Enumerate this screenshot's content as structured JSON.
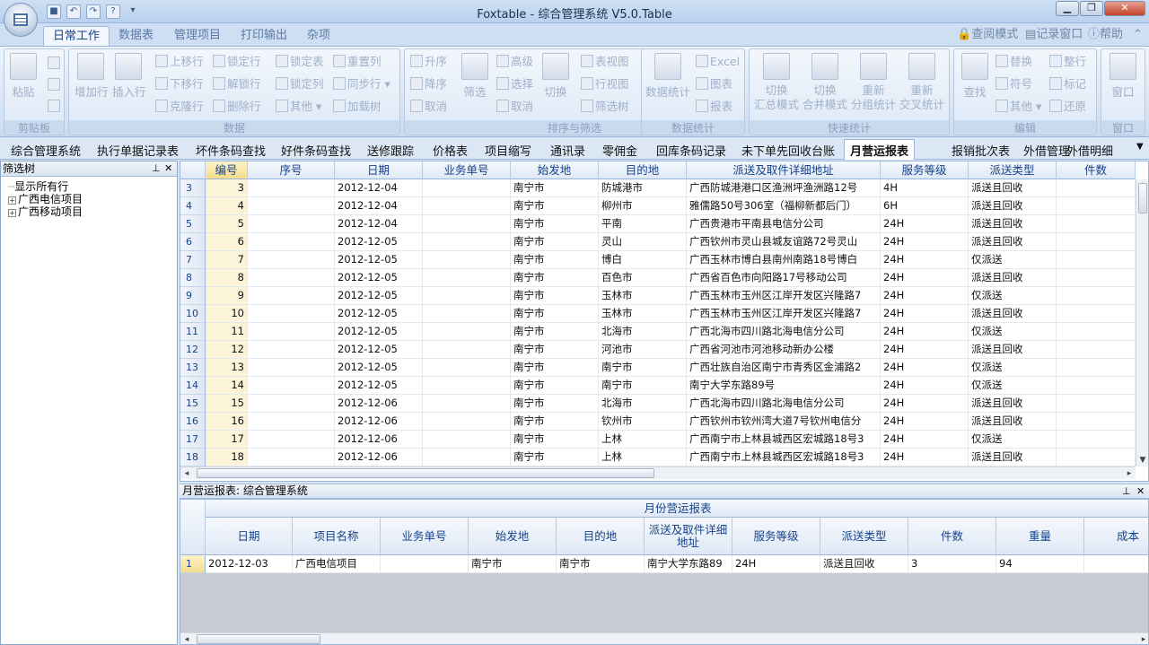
{
  "window": {
    "title": "Foxtable - 综合管理系统 V5.0.Table"
  },
  "ribbon_tabs": [
    "日常工作",
    "数据表",
    "管理项目",
    "打印输出",
    "杂项"
  ],
  "ribbon_right": [
    "查阅模式",
    "记录窗口",
    "帮助"
  ],
  "groups": {
    "clipboard": {
      "label": "剪贴板",
      "paste": "粘贴"
    },
    "data": {
      "label": "数据",
      "add_row": "增加行",
      "insert_row": "插入行",
      "items": [
        "上移行",
        "锁定行",
        "锁定表",
        "重置列",
        "下移行",
        "解锁行",
        "锁定列",
        "同步行",
        "克隆行",
        "删除行",
        "其他",
        "加载树"
      ]
    },
    "sort_filter": {
      "label": "排序与筛选",
      "asc": "升序",
      "desc": "降序",
      "cancel": "取消",
      "filter": "筛选",
      "advanced": "高级",
      "select": "选择",
      "cancel2": "取消",
      "switch": "切换",
      "table_view": "表视图",
      "row_view": "行视图",
      "filter_tree": "筛选树"
    },
    "stats": {
      "label": "数据统计",
      "data_stats": "数据统计",
      "excel": "Excel",
      "chart": "图表",
      "report": "报表"
    },
    "quick_stats": {
      "label": "快速统计",
      "b1": "切换\n汇总模式",
      "b2": "切换\n合并模式",
      "b3": "重新\n分组统计",
      "b4": "重新\n交叉统计"
    },
    "edit": {
      "label": "编辑",
      "find": "查找",
      "replace": "替换",
      "symbol": "符号",
      "other": "其他",
      "tidy": "整行",
      "mark": "标记",
      "restore": "还原"
    },
    "window": {
      "label": "窗口",
      "window": "窗口"
    }
  },
  "table_tabs": [
    "综合管理系统",
    "执行单据记录表",
    "坏件条码查找",
    "好件条码查找",
    "送修跟踪",
    "价格表",
    "项目缩写",
    "通讯录",
    "零佣金",
    "回库条码记录",
    "未下单先回收台账",
    "月营运报表",
    "报销批次表",
    "外借管理",
    "外借明细"
  ],
  "active_table_tab": "月营运报表",
  "filter_panel": {
    "title": "筛选树",
    "nodes": [
      "显示所有行",
      "广西电信项目",
      "广西移动项目"
    ]
  },
  "main_grid": {
    "columns": [
      "编号",
      "序号",
      "日期",
      "业务单号",
      "始发地",
      "目的地",
      "派送及取件详细地址",
      "服务等级",
      "派送类型",
      "件数"
    ],
    "rows": [
      [
        "3",
        "3",
        "",
        "2012-12-04",
        "",
        "南宁市",
        "防城港市",
        "广西防城港港口区渔洲坪渔洲路12号",
        "4H",
        "派送且回收"
      ],
      [
        "4",
        "4",
        "",
        "2012-12-04",
        "",
        "南宁市",
        "柳州市",
        "雅儒路50号306室（福柳新都后门）",
        "6H",
        "派送且回收"
      ],
      [
        "5",
        "5",
        "",
        "2012-12-04",
        "",
        "南宁市",
        "平南",
        "广西贵港市平南县电信分公司",
        "24H",
        "派送且回收"
      ],
      [
        "6",
        "6",
        "",
        "2012-12-05",
        "",
        "南宁市",
        "灵山",
        "广西钦州市灵山县城友谊路72号灵山",
        "24H",
        "派送且回收"
      ],
      [
        "7",
        "7",
        "",
        "2012-12-05",
        "",
        "南宁市",
        "博白",
        "广西玉林市博白县南州南路18号博白",
        "24H",
        "仅派送"
      ],
      [
        "8",
        "8",
        "",
        "2012-12-05",
        "",
        "南宁市",
        "百色市",
        "广西省百色市向阳路17号移动公司",
        "24H",
        "派送且回收"
      ],
      [
        "9",
        "9",
        "",
        "2012-12-05",
        "",
        "南宁市",
        "玉林市",
        "广西玉林市玉州区江岸开发区兴隆路7",
        "24H",
        "仅派送"
      ],
      [
        "10",
        "10",
        "",
        "2012-12-05",
        "",
        "南宁市",
        "玉林市",
        "广西玉林市玉州区江岸开发区兴隆路7",
        "24H",
        "派送且回收"
      ],
      [
        "11",
        "11",
        "",
        "2012-12-05",
        "",
        "南宁市",
        "北海市",
        "广西北海市四川路北海电信分公司",
        "24H",
        "仅派送"
      ],
      [
        "12",
        "12",
        "",
        "2012-12-05",
        "",
        "南宁市",
        "河池市",
        "广西省河池市河池移动新办公楼",
        "24H",
        "派送且回收"
      ],
      [
        "13",
        "13",
        "",
        "2012-12-05",
        "",
        "南宁市",
        "南宁市",
        "广西壮族自治区南宁市青秀区金浦路2",
        "24H",
        "仅派送"
      ],
      [
        "14",
        "14",
        "",
        "2012-12-05",
        "",
        "南宁市",
        "南宁市",
        "南宁大学东路89号",
        "24H",
        "仅派送"
      ],
      [
        "15",
        "15",
        "",
        "2012-12-06",
        "",
        "南宁市",
        "北海市",
        "广西北海市四川路北海电信分公司",
        "24H",
        "派送且回收"
      ],
      [
        "16",
        "16",
        "",
        "2012-12-06",
        "",
        "南宁市",
        "钦州市",
        "广西钦州市钦州湾大道7号钦州电信分",
        "24H",
        "派送且回收"
      ],
      [
        "17",
        "17",
        "",
        "2012-12-06",
        "",
        "南宁市",
        "上林",
        "广西南宁市上林县城西区宏城路18号3",
        "24H",
        "仅派送"
      ],
      [
        "18",
        "18",
        "",
        "2012-12-06",
        "",
        "南宁市",
        "上林",
        "广西南宁市上林县城西区宏城路18号3",
        "24H",
        "派送且回收"
      ]
    ]
  },
  "bottom_panel": {
    "title": "月营运报表: 综合管理系统",
    "report_title": "月份营运报表",
    "columns": [
      "日期",
      "项目名称",
      "业务单号",
      "始发地",
      "目的地",
      "派送及取件详细\n地址",
      "服务等级",
      "派送类型",
      "件数",
      "重量",
      "成本"
    ],
    "rows": [
      [
        "1",
        "2012-12-03",
        "广西电信项目",
        "",
        "南宁市",
        "南宁市",
        "南宁大学东路89",
        "24H",
        "派送且回收",
        "3",
        "94",
        ""
      ]
    ]
  }
}
